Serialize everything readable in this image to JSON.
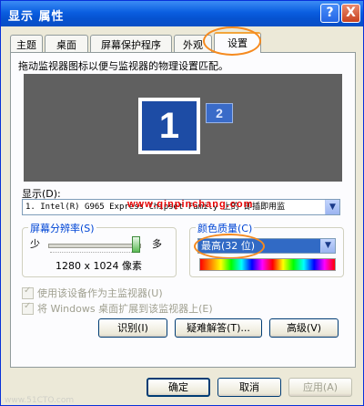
{
  "window": {
    "title": "显示 属性",
    "help_label": "?",
    "close_label": "X"
  },
  "tabs": [
    {
      "label": "主题"
    },
    {
      "label": "桌面"
    },
    {
      "label": "屏幕保护程序"
    },
    {
      "label": "外观"
    },
    {
      "label": "设置"
    }
  ],
  "settings": {
    "description": "拖动监视器图标以便与监视器的物理设置匹配。",
    "monitor_primary": "1",
    "monitor_secondary": "2",
    "display_label": "显示(D):",
    "display_value": "1. Intel(R) G965 Express Chipset Family 上的 即插即用监",
    "watermark": "www.qinpinchang.com",
    "resolution": {
      "title": "屏幕分辨率(S)",
      "less_label": "少",
      "more_label": "多",
      "value": "1280 x 1024 像素",
      "slider_level": 1.0
    },
    "color_quality": {
      "title": "颜色质量(C)",
      "value": "最高(32 位)"
    },
    "checkbox_primary": "使用该设备作为主监视器(U)",
    "checkbox_extend": "将 Windows 桌面扩展到该监视器上(E)",
    "identify_label": "识别(I)",
    "troubleshoot_label": "疑难解答(T)...",
    "advanced_label": "高级(V)"
  },
  "footer": {
    "ok_label": "确定",
    "cancel_label": "取消",
    "apply_label": "应用(A)",
    "source_text": "www.51CTO.com"
  },
  "colors": {
    "title_bar": "#0a5ee0",
    "highlight_ring": "#f58a1f",
    "selection": "#316ac5",
    "monitor_bg": "#606060"
  }
}
